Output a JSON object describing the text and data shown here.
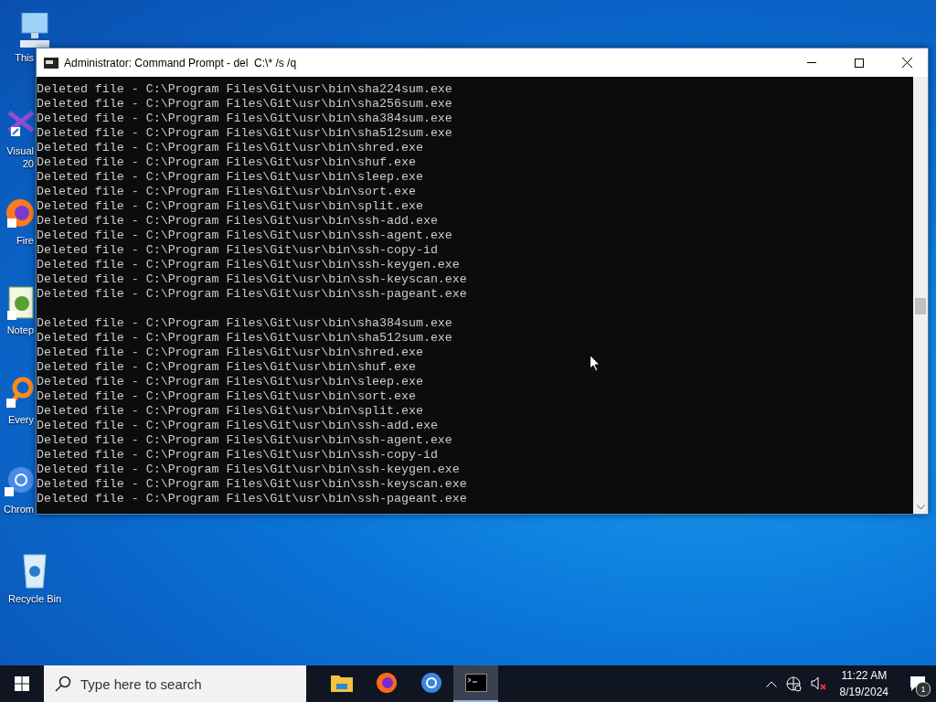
{
  "desktop_icons": [
    {
      "kind": "computer",
      "lines": [
        "This"
      ]
    },
    {
      "kind": "studio",
      "lines": [
        "Visual",
        "20"
      ]
    },
    {
      "kind": "firefox",
      "lines": [
        "Fire"
      ]
    },
    {
      "kind": "notepad",
      "lines": [
        "Notep"
      ]
    },
    {
      "kind": "everything",
      "lines": [
        "Every"
      ]
    },
    {
      "kind": "chromium",
      "lines": [
        "Chrom"
      ]
    },
    {
      "kind": "recycle",
      "lines": [
        "Recycle Bin"
      ]
    }
  ],
  "window": {
    "title": "Administrator: Command Prompt - del  C:\\* /s /q",
    "console_lines": [
      {
        "kind": "text",
        "text": "Deleted file - C:\\Program Files\\Git\\usr\\bin\\sha224sum.exe"
      },
      {
        "kind": "text",
        "text": "Deleted file - C:\\Program Files\\Git\\usr\\bin\\sha256sum.exe"
      },
      {
        "kind": "text",
        "text": "Deleted file - C:\\Program Files\\Git\\usr\\bin\\sha384sum.exe"
      },
      {
        "kind": "text",
        "text": "Deleted file - C:\\Program Files\\Git\\usr\\bin\\sha512sum.exe"
      },
      {
        "kind": "text",
        "text": "Deleted file - C:\\Program Files\\Git\\usr\\bin\\shred.exe"
      },
      {
        "kind": "text",
        "text": "Deleted file - C:\\Program Files\\Git\\usr\\bin\\shuf.exe"
      },
      {
        "kind": "text",
        "text": "Deleted file - C:\\Program Files\\Git\\usr\\bin\\sleep.exe"
      },
      {
        "kind": "text",
        "text": "Deleted file - C:\\Program Files\\Git\\usr\\bin\\sort.exe"
      },
      {
        "kind": "text",
        "text": "Deleted file - C:\\Program Files\\Git\\usr\\bin\\split.exe"
      },
      {
        "kind": "text",
        "text": "Deleted file - C:\\Program Files\\Git\\usr\\bin\\ssh-add.exe"
      },
      {
        "kind": "text",
        "text": "Deleted file - C:\\Program Files\\Git\\usr\\bin\\ssh-agent.exe"
      },
      {
        "kind": "text",
        "text": "Deleted file - C:\\Program Files\\Git\\usr\\bin\\ssh-copy-id"
      },
      {
        "kind": "text",
        "text": "Deleted file - C:\\Program Files\\Git\\usr\\bin\\ssh-keygen.exe"
      },
      {
        "kind": "text",
        "text": "Deleted file - C:\\Program Files\\Git\\usr\\bin\\ssh-keyscan.exe"
      },
      {
        "kind": "text",
        "text": "Deleted file - C:\\Program Files\\Git\\usr\\bin\\ssh-pageant.exe"
      },
      {
        "kind": "blank"
      },
      {
        "kind": "text",
        "text": "Deleted file - C:\\Program Files\\Git\\usr\\bin\\sha384sum.exe"
      },
      {
        "kind": "text",
        "text": "Deleted file - C:\\Program Files\\Git\\usr\\bin\\sha512sum.exe"
      },
      {
        "kind": "text",
        "text": "Deleted file - C:\\Program Files\\Git\\usr\\bin\\shred.exe"
      },
      {
        "kind": "text",
        "text": "Deleted file - C:\\Program Files\\Git\\usr\\bin\\shuf.exe"
      },
      {
        "kind": "text",
        "text": "Deleted file - C:\\Program Files\\Git\\usr\\bin\\sleep.exe"
      },
      {
        "kind": "text",
        "text": "Deleted file - C:\\Program Files\\Git\\usr\\bin\\sort.exe"
      },
      {
        "kind": "text",
        "text": "Deleted file - C:\\Program Files\\Git\\usr\\bin\\split.exe"
      },
      {
        "kind": "text",
        "text": "Deleted file - C:\\Program Files\\Git\\usr\\bin\\ssh-add.exe"
      },
      {
        "kind": "text",
        "text": "Deleted file - C:\\Program Files\\Git\\usr\\bin\\ssh-agent.exe"
      },
      {
        "kind": "text",
        "text": "Deleted file - C:\\Program Files\\Git\\usr\\bin\\ssh-copy-id"
      },
      {
        "kind": "text",
        "text": "Deleted file - C:\\Program Files\\Git\\usr\\bin\\ssh-keygen.exe"
      },
      {
        "kind": "text",
        "text": "Deleted file - C:\\Program Files\\Git\\usr\\bin\\ssh-keyscan.exe"
      },
      {
        "kind": "text",
        "text": "Deleted file - C:\\Program Files\\Git\\usr\\bin\\ssh-pageant.exe"
      }
    ]
  },
  "taskbar": {
    "search": {
      "placeholder": "Type here to search"
    },
    "apps": [
      {
        "kind": "folder",
        "selected": false
      },
      {
        "kind": "firefox",
        "selected": false
      },
      {
        "kind": "chromium",
        "selected": false
      },
      {
        "kind": "console",
        "selected": true
      }
    ],
    "clock": {
      "time": "11:22 AM",
      "date": "8/19/2024"
    },
    "notifications": {
      "badge": "1"
    }
  }
}
